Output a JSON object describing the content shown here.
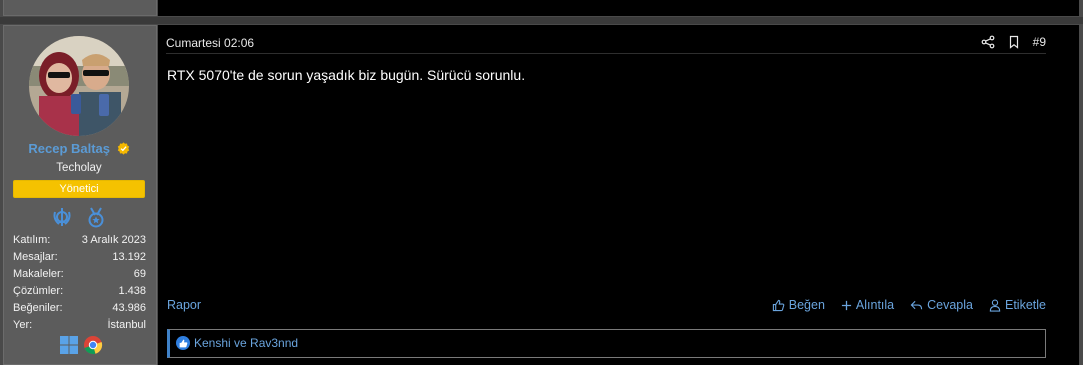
{
  "post": {
    "user": {
      "name": "Recep Baltaş",
      "title": "Techolay",
      "role_badge": "Yönetici",
      "trophies": [
        "jedi-icon",
        "medal-icon"
      ],
      "stats": [
        {
          "label": "Katılım:",
          "value": "3 Aralık 2023"
        },
        {
          "label": "Mesajlar:",
          "value": "13.192"
        },
        {
          "label": "Makaleler:",
          "value": "69"
        },
        {
          "label": "Çözümler:",
          "value": "1.438"
        },
        {
          "label": "Beğeniler:",
          "value": "43.986"
        },
        {
          "label": "Yer:",
          "value": "İstanbul"
        }
      ],
      "platforms": [
        "windows-icon",
        "chrome-icon"
      ],
      "role_color": "#f5c200",
      "name_color": "#5b9bd5"
    },
    "date": "Cumartesi 02:06",
    "number": "#9",
    "content": "RTX 5070'te de sorun yaşadık biz bugün. Sürücü sorunlu.",
    "actions": {
      "report": "Rapor",
      "like": "Beğen",
      "quote": "Alıntıla",
      "reply": "Cevapla",
      "tag": "Etiketle"
    },
    "reactions": "Kenshi ve Rav3nnd"
  }
}
